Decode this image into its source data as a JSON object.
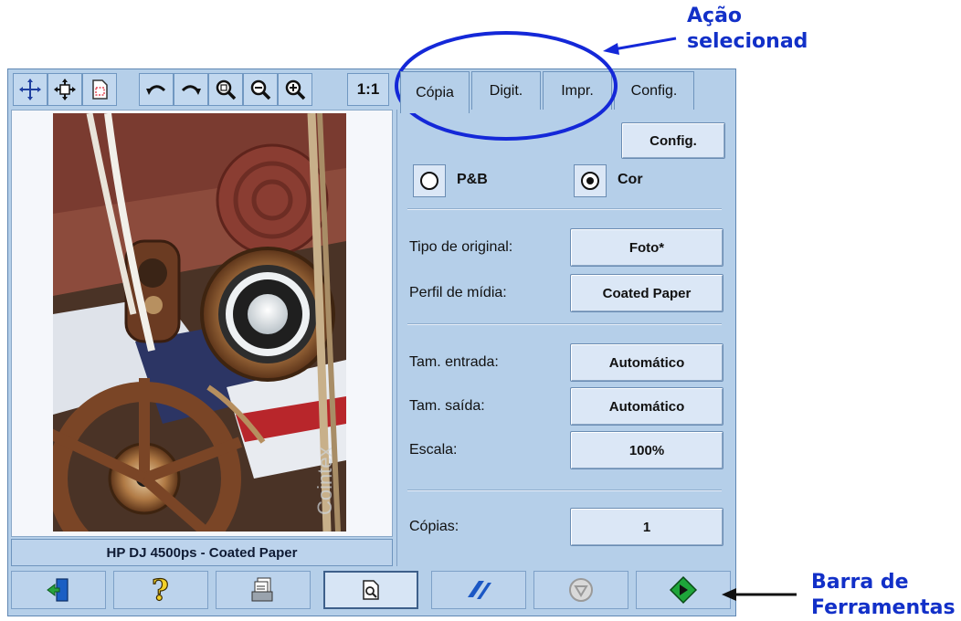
{
  "toolbar": {
    "buttons": [
      {
        "icon": "move-cross-icon"
      },
      {
        "icon": "pan-icon"
      },
      {
        "icon": "page-select-icon"
      },
      {
        "icon": "rotate-left-icon"
      },
      {
        "icon": "rotate-right-icon"
      },
      {
        "icon": "zoom-fit-icon"
      },
      {
        "icon": "zoom-out-icon"
      },
      {
        "icon": "zoom-in-icon"
      },
      {
        "icon": "actual-size-icon",
        "label": "1:1"
      }
    ]
  },
  "tabs": [
    {
      "label": "Cópia",
      "active": true
    },
    {
      "label": "Digit.",
      "active": false
    },
    {
      "label": "Impr.",
      "active": false
    },
    {
      "label": "Config.",
      "active": false
    }
  ],
  "panel": {
    "config_button": "Config.",
    "color_mode": {
      "bw_label": "P&B",
      "color_label": "Cor",
      "selected": "Cor"
    },
    "original_type": {
      "label": "Tipo de original:",
      "value": "Foto*"
    },
    "media_profile": {
      "label": "Perfil de mídia:",
      "value": "Coated Paper"
    },
    "input_size": {
      "label": "Tam. entrada:",
      "value": "Automático"
    },
    "output_size": {
      "label": "Tam. saída:",
      "value": "Automático"
    },
    "scale": {
      "label": "Escala:",
      "value": "100%"
    },
    "copies": {
      "label": "Cópias:",
      "value": "1"
    }
  },
  "preview": {
    "status": "HP DJ 4500ps - Coated Paper",
    "watermark": "Cointex"
  },
  "bottom_toolbar": [
    {
      "icon": "exit-icon"
    },
    {
      "icon": "help-icon"
    },
    {
      "icon": "print-queue-icon"
    },
    {
      "icon": "preview-icon",
      "pressed": true
    },
    {
      "icon": "scan-to-file-icon"
    },
    {
      "icon": "stop-icon"
    },
    {
      "icon": "start-icon"
    }
  ],
  "annotations": {
    "top": {
      "line1": "Ação",
      "line2": "selecionad"
    },
    "bottom": {
      "line1": "Barra de",
      "line2": "Ferramentas"
    }
  },
  "colors": {
    "panel_bg": "#b5cfe9",
    "annotation": "#1230c8",
    "start_green": "#1ea53a"
  }
}
